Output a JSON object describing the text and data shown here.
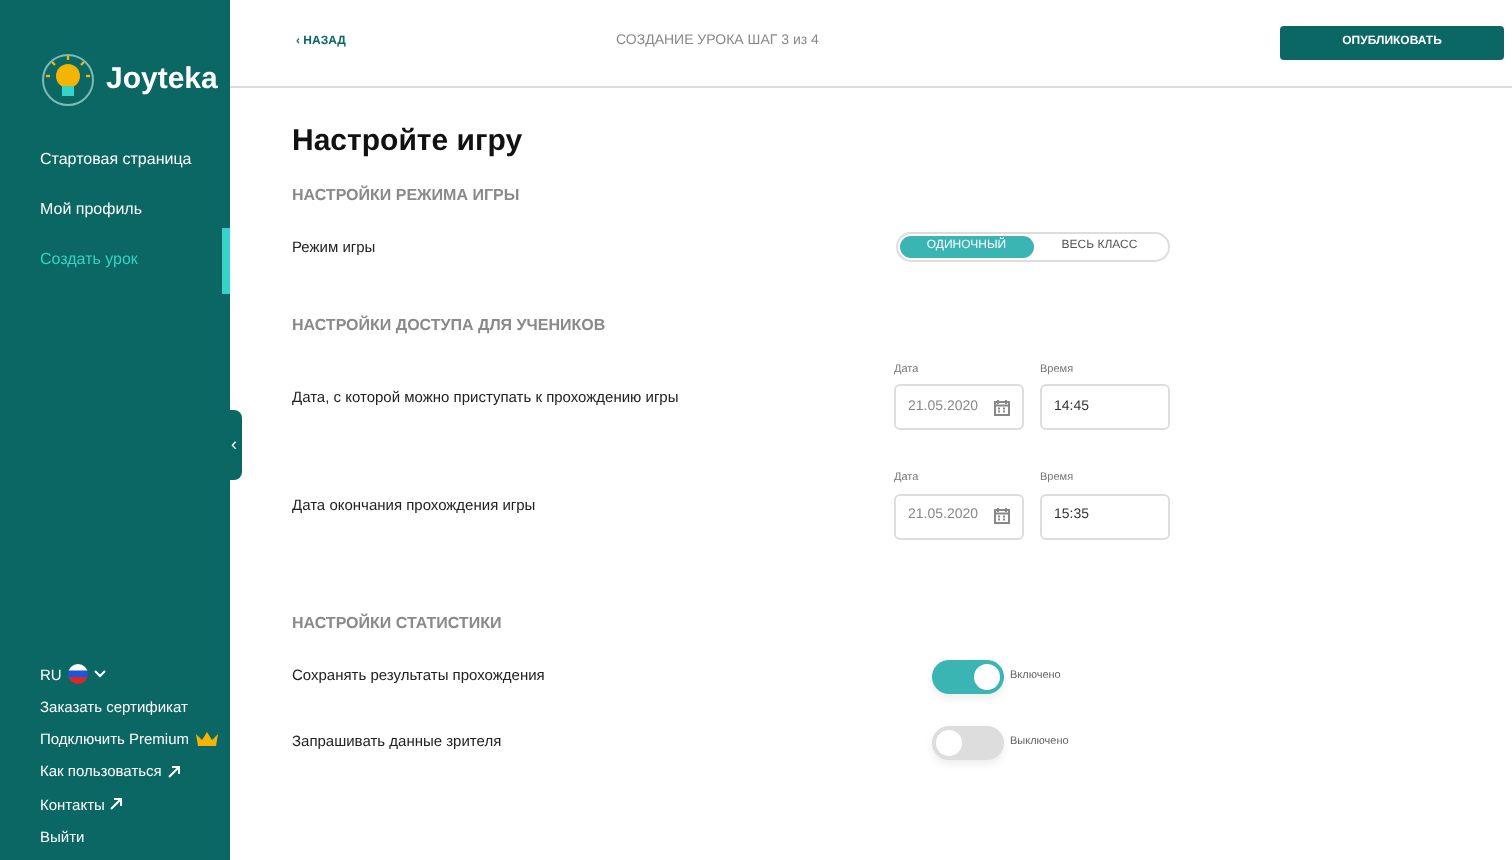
{
  "sidebar": {
    "logo": "Joyteka",
    "nav": [
      {
        "label": "Стартовая страница",
        "selected": false
      },
      {
        "label": "Мой профиль",
        "selected": false
      },
      {
        "label": "Создать урок",
        "selected": true
      }
    ],
    "collapse": "‹",
    "language": "RU",
    "links": [
      {
        "label": "Заказать сертификат",
        "kind": "plain"
      },
      {
        "label": "Подключить Premium",
        "kind": "premium"
      },
      {
        "label": "Как пользоваться",
        "kind": "external"
      },
      {
        "label": "Контакты",
        "kind": "external"
      },
      {
        "label": "Выйти",
        "kind": "plain"
      }
    ]
  },
  "header": {
    "back": "‹ НАЗАД",
    "step": "СОЗДАНИЕ УРОКА ШАГ 3 из 4",
    "publish": "ОПУБЛИКОВАТЬ"
  },
  "title": "Настройте игру",
  "sections": [
    {
      "heading": "НАСТРОЙКИ РЕЖИМА ИГРЫ",
      "rows": [
        {
          "kind": "segmented",
          "label": "Режим игры",
          "options": [
            {
              "label": "ОДИНОЧНЫЙ",
              "selected": true
            },
            {
              "label": "ВЕСЬ КЛАСС",
              "selected": false
            }
          ]
        }
      ]
    },
    {
      "heading": "НАСТРОЙКИ ДОСТУПА ДЛЯ УЧЕНИКОВ",
      "rows": [
        {
          "kind": "datetime",
          "label": "Дата, с которой можно приступать к прохождению игры",
          "date_label": "Дата",
          "date": "21.05.2020",
          "time_label": "Время",
          "time": "14:45"
        },
        {
          "kind": "datetime",
          "label": "Дата окончания прохождения игры",
          "date_label": "Дата",
          "date": "21.05.2020",
          "time_label": "Время",
          "time": "15:35"
        }
      ]
    },
    {
      "heading": "НАСТРОЙКИ СТАТИСТИКИ",
      "rows": [
        {
          "kind": "switch",
          "label": "Сохранять результаты прохождения",
          "on": true,
          "state": "Включено"
        },
        {
          "kind": "switch",
          "label": "Запрашивать данные зрителя",
          "on": false,
          "state": "Выключено"
        }
      ]
    }
  ]
}
